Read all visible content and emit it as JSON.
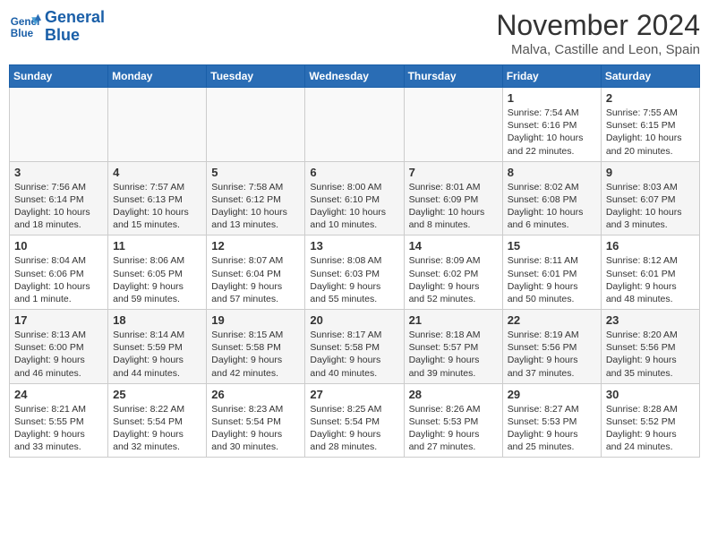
{
  "header": {
    "logo_line1": "General",
    "logo_line2": "Blue",
    "month": "November 2024",
    "location": "Malva, Castille and Leon, Spain"
  },
  "weekdays": [
    "Sunday",
    "Monday",
    "Tuesday",
    "Wednesday",
    "Thursday",
    "Friday",
    "Saturday"
  ],
  "weeks": [
    [
      {
        "day": "",
        "info": ""
      },
      {
        "day": "",
        "info": ""
      },
      {
        "day": "",
        "info": ""
      },
      {
        "day": "",
        "info": ""
      },
      {
        "day": "",
        "info": ""
      },
      {
        "day": "1",
        "info": "Sunrise: 7:54 AM\nSunset: 6:16 PM\nDaylight: 10 hours and 22 minutes."
      },
      {
        "day": "2",
        "info": "Sunrise: 7:55 AM\nSunset: 6:15 PM\nDaylight: 10 hours and 20 minutes."
      }
    ],
    [
      {
        "day": "3",
        "info": "Sunrise: 7:56 AM\nSunset: 6:14 PM\nDaylight: 10 hours and 18 minutes."
      },
      {
        "day": "4",
        "info": "Sunrise: 7:57 AM\nSunset: 6:13 PM\nDaylight: 10 hours and 15 minutes."
      },
      {
        "day": "5",
        "info": "Sunrise: 7:58 AM\nSunset: 6:12 PM\nDaylight: 10 hours and 13 minutes."
      },
      {
        "day": "6",
        "info": "Sunrise: 8:00 AM\nSunset: 6:10 PM\nDaylight: 10 hours and 10 minutes."
      },
      {
        "day": "7",
        "info": "Sunrise: 8:01 AM\nSunset: 6:09 PM\nDaylight: 10 hours and 8 minutes."
      },
      {
        "day": "8",
        "info": "Sunrise: 8:02 AM\nSunset: 6:08 PM\nDaylight: 10 hours and 6 minutes."
      },
      {
        "day": "9",
        "info": "Sunrise: 8:03 AM\nSunset: 6:07 PM\nDaylight: 10 hours and 3 minutes."
      }
    ],
    [
      {
        "day": "10",
        "info": "Sunrise: 8:04 AM\nSunset: 6:06 PM\nDaylight: 10 hours and 1 minute."
      },
      {
        "day": "11",
        "info": "Sunrise: 8:06 AM\nSunset: 6:05 PM\nDaylight: 9 hours and 59 minutes."
      },
      {
        "day": "12",
        "info": "Sunrise: 8:07 AM\nSunset: 6:04 PM\nDaylight: 9 hours and 57 minutes."
      },
      {
        "day": "13",
        "info": "Sunrise: 8:08 AM\nSunset: 6:03 PM\nDaylight: 9 hours and 55 minutes."
      },
      {
        "day": "14",
        "info": "Sunrise: 8:09 AM\nSunset: 6:02 PM\nDaylight: 9 hours and 52 minutes."
      },
      {
        "day": "15",
        "info": "Sunrise: 8:11 AM\nSunset: 6:01 PM\nDaylight: 9 hours and 50 minutes."
      },
      {
        "day": "16",
        "info": "Sunrise: 8:12 AM\nSunset: 6:01 PM\nDaylight: 9 hours and 48 minutes."
      }
    ],
    [
      {
        "day": "17",
        "info": "Sunrise: 8:13 AM\nSunset: 6:00 PM\nDaylight: 9 hours and 46 minutes."
      },
      {
        "day": "18",
        "info": "Sunrise: 8:14 AM\nSunset: 5:59 PM\nDaylight: 9 hours and 44 minutes."
      },
      {
        "day": "19",
        "info": "Sunrise: 8:15 AM\nSunset: 5:58 PM\nDaylight: 9 hours and 42 minutes."
      },
      {
        "day": "20",
        "info": "Sunrise: 8:17 AM\nSunset: 5:58 PM\nDaylight: 9 hours and 40 minutes."
      },
      {
        "day": "21",
        "info": "Sunrise: 8:18 AM\nSunset: 5:57 PM\nDaylight: 9 hours and 39 minutes."
      },
      {
        "day": "22",
        "info": "Sunrise: 8:19 AM\nSunset: 5:56 PM\nDaylight: 9 hours and 37 minutes."
      },
      {
        "day": "23",
        "info": "Sunrise: 8:20 AM\nSunset: 5:56 PM\nDaylight: 9 hours and 35 minutes."
      }
    ],
    [
      {
        "day": "24",
        "info": "Sunrise: 8:21 AM\nSunset: 5:55 PM\nDaylight: 9 hours and 33 minutes."
      },
      {
        "day": "25",
        "info": "Sunrise: 8:22 AM\nSunset: 5:54 PM\nDaylight: 9 hours and 32 minutes."
      },
      {
        "day": "26",
        "info": "Sunrise: 8:23 AM\nSunset: 5:54 PM\nDaylight: 9 hours and 30 minutes."
      },
      {
        "day": "27",
        "info": "Sunrise: 8:25 AM\nSunset: 5:54 PM\nDaylight: 9 hours and 28 minutes."
      },
      {
        "day": "28",
        "info": "Sunrise: 8:26 AM\nSunset: 5:53 PM\nDaylight: 9 hours and 27 minutes."
      },
      {
        "day": "29",
        "info": "Sunrise: 8:27 AM\nSunset: 5:53 PM\nDaylight: 9 hours and 25 minutes."
      },
      {
        "day": "30",
        "info": "Sunrise: 8:28 AM\nSunset: 5:52 PM\nDaylight: 9 hours and 24 minutes."
      }
    ]
  ]
}
